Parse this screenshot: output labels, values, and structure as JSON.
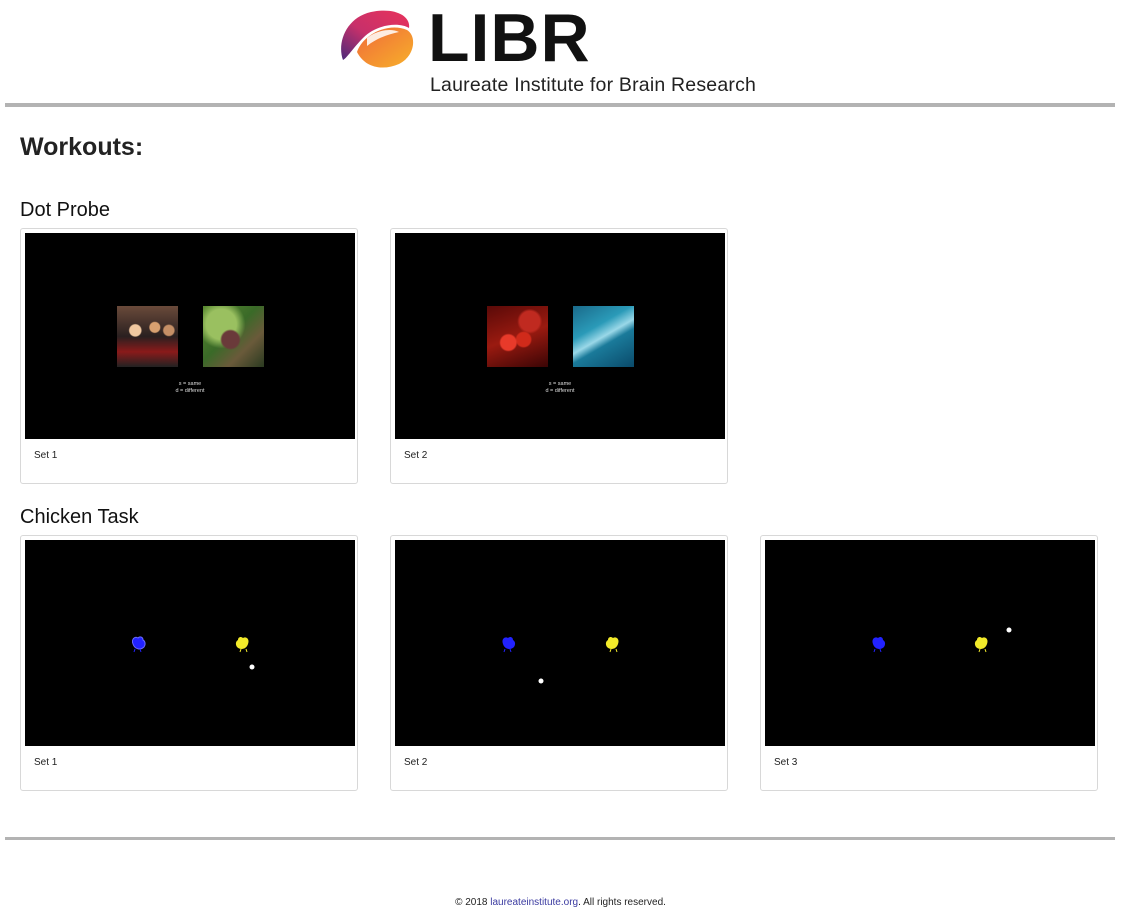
{
  "header": {
    "logo_word": "LIBR",
    "logo_subtitle": "Laureate Institute for Brain Research"
  },
  "page_title": "Workouts:",
  "sections": [
    {
      "title": "Dot Probe",
      "cards": [
        {
          "label": "Set 1",
          "key_line1": "s = same",
          "key_line2": "d = different"
        },
        {
          "label": "Set 2",
          "key_line1": "s = same",
          "key_line2": "d = different"
        }
      ]
    },
    {
      "title": "Chicken Task",
      "cards": [
        {
          "label": "Set 1"
        },
        {
          "label": "Set 2"
        },
        {
          "label": "Set 3"
        }
      ]
    }
  ],
  "footer": {
    "prefix": "© 2018 ",
    "link": "laureateinstitute.org",
    "suffix": ". All rights reserved."
  },
  "colors": {
    "logo_gradient": [
      "#7a2a8f",
      "#e8335b",
      "#f59a2a"
    ],
    "chicken_blue": "#2222ff",
    "chicken_yellow": "#f2ea2a"
  }
}
